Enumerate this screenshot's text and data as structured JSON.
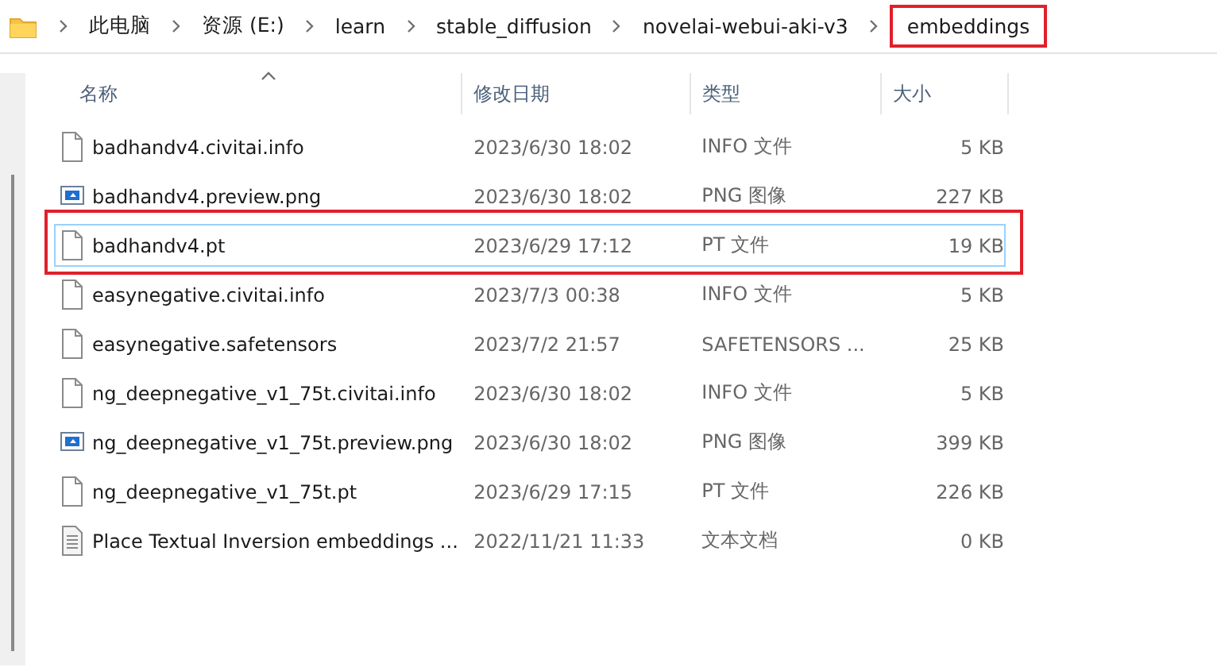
{
  "breadcrumb": [
    {
      "label": "此电脑",
      "annotated": false
    },
    {
      "label": "资源 (E:)",
      "annotated": false
    },
    {
      "label": "learn",
      "annotated": false
    },
    {
      "label": "stable_diffusion",
      "annotated": false
    },
    {
      "label": "novelai-webui-aki-v3",
      "annotated": false
    },
    {
      "label": "embeddings",
      "annotated": true
    }
  ],
  "columns": [
    "名称",
    "修改日期",
    "类型",
    "大小"
  ],
  "rows": [
    {
      "kind": "document",
      "name": "badhandv4.civitai.info",
      "date": "2023/6/30 18:02",
      "type": "INFO 文件",
      "size": "5 KB",
      "selected": false,
      "annotated": false
    },
    {
      "kind": "image",
      "name": "badhandv4.preview.png",
      "date": "2023/6/30 18:02",
      "type": "PNG 图像",
      "size": "227 KB",
      "selected": false,
      "annotated": false
    },
    {
      "kind": "document",
      "name": "badhandv4.pt",
      "date": "2023/6/29 17:12",
      "type": "PT 文件",
      "size": "19 KB",
      "selected": true,
      "annotated": true
    },
    {
      "kind": "document",
      "name": "easynegative.civitai.info",
      "date": "2023/7/3 00:38",
      "type": "INFO 文件",
      "size": "5 KB",
      "selected": false,
      "annotated": false
    },
    {
      "kind": "document",
      "name": "easynegative.safetensors",
      "date": "2023/7/2 21:57",
      "type": "SAFETENSORS ...",
      "size": "25 KB",
      "selected": false,
      "annotated": false
    },
    {
      "kind": "document",
      "name": "ng_deepnegative_v1_75t.civitai.info",
      "date": "2023/6/30 18:02",
      "type": "INFO 文件",
      "size": "5 KB",
      "selected": false,
      "annotated": false
    },
    {
      "kind": "image",
      "name": "ng_deepnegative_v1_75t.preview.png",
      "date": "2023/6/30 18:02",
      "type": "PNG 图像",
      "size": "399 KB",
      "selected": false,
      "annotated": false
    },
    {
      "kind": "document",
      "name": "ng_deepnegative_v1_75t.pt",
      "date": "2023/6/29 17:15",
      "type": "PT 文件",
      "size": "226 KB",
      "selected": false,
      "annotated": false
    },
    {
      "kind": "text",
      "name": "Place Textual Inversion embeddings ...",
      "date": "2022/11/21 11:33",
      "type": "文本文档",
      "size": "0 KB",
      "selected": false,
      "annotated": false
    }
  ]
}
